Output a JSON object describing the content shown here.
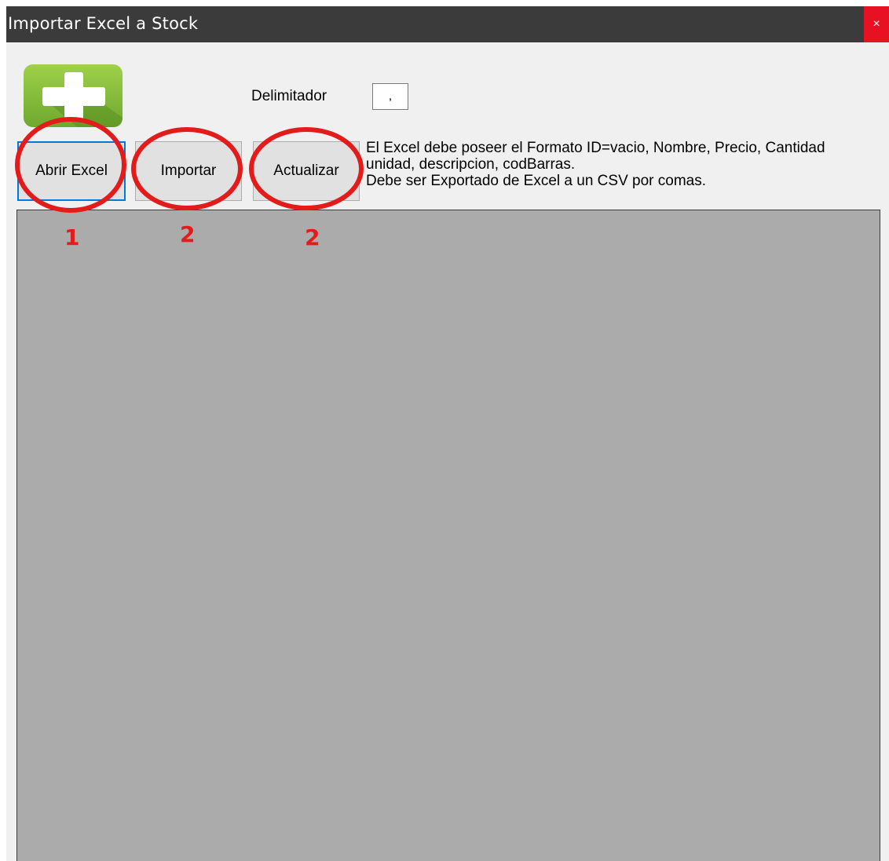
{
  "window": {
    "title": "Importar Excel a Stock",
    "close_label": "×"
  },
  "toolbar": {
    "add_icon": "plus-icon",
    "delimiter_label": "Delimitador",
    "delimiter_value": ",",
    "open_label": "Abrir Excel",
    "import_label": "Importar",
    "update_label": "Actualizar"
  },
  "instructions": "El Excel debe poseer el Formato ID=vacio, Nombre, Precio, Cantidad\nunidad, descripcion, codBarras.\nDebe ser Exportado de Excel a un CSV por comas.",
  "annotations": {
    "color": "#e31b1b",
    "steps": [
      "1",
      "2",
      "2"
    ]
  },
  "colors": {
    "titlebar": "#3b3b3b",
    "close": "#e81123",
    "grid": "#ababab",
    "focus": "#0078d7",
    "icon_green": "#8cc63f"
  }
}
